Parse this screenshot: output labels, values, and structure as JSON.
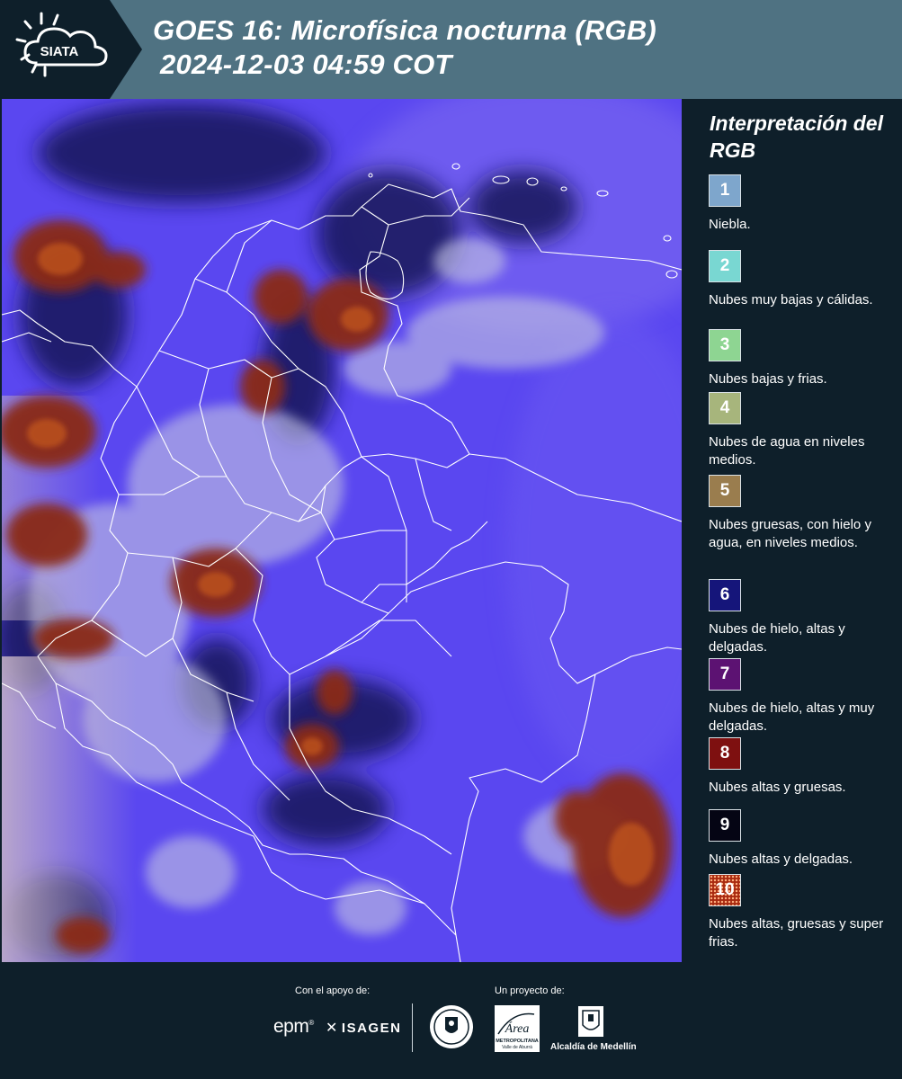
{
  "header": {
    "logo_text": "SIATA",
    "title_line1": "GOES 16: Microfísica nocturna (RGB)",
    "title_line2": "2024-12-03 04:59 COT"
  },
  "legend": {
    "title": "Interpretación del RGB",
    "items": [
      {
        "number": "1",
        "label": "Niebla.",
        "color": "#7ea6cc"
      },
      {
        "number": "2",
        "label": "Nubes muy bajas y cálidas.",
        "color": "#79d7d2"
      },
      {
        "number": "3",
        "label": "Nubes bajas y frias.",
        "color": "#8ed592"
      },
      {
        "number": "4",
        "label": "Nubes de agua en niveles medios.",
        "color": "#a7b57c"
      },
      {
        "number": "5",
        "label": "Nubes gruesas, con hielo y agua, en niveles medios.",
        "color": "#9a7d4e"
      },
      {
        "number": "6",
        "label": "Nubes de hielo, altas y delgadas.",
        "color": "#15157a"
      },
      {
        "number": "7",
        "label": "Nubes de hielo, altas y muy delgadas.",
        "color": "#5c1272"
      },
      {
        "number": "8",
        "label": "Nubes altas y gruesas.",
        "color": "#7e1010"
      },
      {
        "number": "9",
        "label": "Nubes altas y delgadas.",
        "color": "#050514"
      },
      {
        "number": "10",
        "label": "Nubes altas, gruesas y super frias.",
        "color": "#a82a10"
      }
    ]
  },
  "footer": {
    "support_label": "Con el apoyo de:",
    "project_label": "Un proyecto de:",
    "sponsor_epm": "epm",
    "sponsor_isagen": "ISAGEN",
    "area_logo_text": "Área",
    "area_logo_sub": "METROPOLITANA",
    "area_logo_sub2": "Valle de Aburrá",
    "alcaldia_label": "Alcaldía de Medellín"
  },
  "map": {
    "background_color": "#5a47f0",
    "border_color": "#ffffff"
  }
}
